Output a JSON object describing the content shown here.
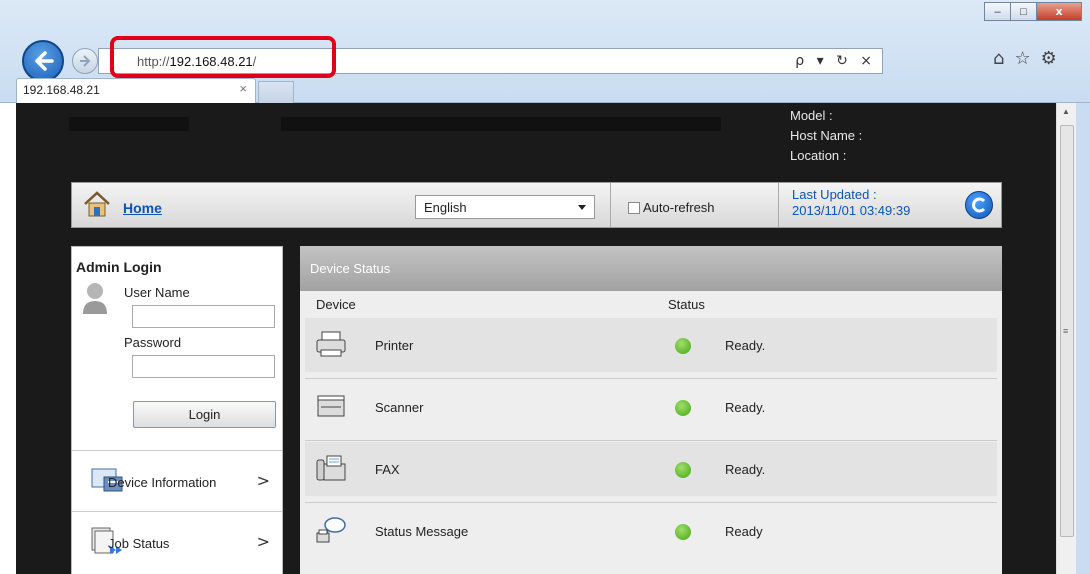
{
  "browser": {
    "url_prefix": "http://",
    "url_host": "192.168.48.21",
    "url_suffix": "/",
    "tab_title": "192.168.48.21",
    "tab_close": "×",
    "address_tools": "ρ ▾ ↻ ×"
  },
  "header": {
    "model_label": "Model :",
    "host_label": "Host Name :",
    "location_label": "Location :"
  },
  "toolbar": {
    "home": "Home",
    "language": "English",
    "auto_refresh": "Auto-refresh",
    "last_updated_label": "Last Updated :",
    "last_updated_value": "2013/11/01 03:49:39"
  },
  "sidebar": {
    "title": "Admin Login",
    "user_name_label": "User Name",
    "password_label": "Password",
    "login_button": "Login",
    "items": [
      {
        "label": "Device Information",
        "chevron": ">"
      },
      {
        "label": "Job Status",
        "chevron": ">"
      }
    ]
  },
  "main": {
    "title": "Device Status",
    "col_device": "Device",
    "col_status": "Status",
    "rows": [
      {
        "device": "Printer",
        "status": "Ready.",
        "icon": "printer-icon"
      },
      {
        "device": "Scanner",
        "status": "Ready.",
        "icon": "scanner-icon"
      },
      {
        "device": "FAX",
        "status": "Ready.",
        "icon": "fax-icon"
      },
      {
        "device": "Status Message",
        "status": "Ready",
        "icon": "status-message-icon"
      }
    ]
  },
  "colors": {
    "link": "#0b55b3",
    "highlight": "#e1001a",
    "ready": "#45a415"
  }
}
